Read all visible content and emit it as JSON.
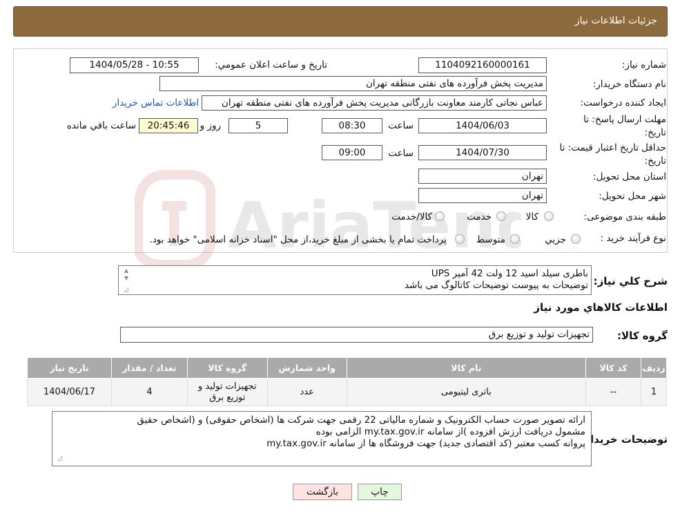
{
  "header": {
    "title": "جزئیات اطلاعات نیاز"
  },
  "form": {
    "need_number_label": "شماره نیاز:",
    "need_number": "1104092160000161",
    "announce_label": "تاریخ و ساعت اعلان عمومي:",
    "announce_value": "1404/05/28 - 10:55",
    "buyer_org_label": "نام دستگاه خریدار:",
    "buyer_org": "مدیریت پخش فرآورده های نفتی منطقه تهران",
    "creator_label": "ایجاد کننده درخواست:",
    "creator": "عباس نجاتی کارمند معاونت بازرگانی مدیریت پخش فرآورده های نفتی منطقه تهران",
    "contact_link": "اطلاعات تماس خریدار",
    "deadline_label": "مهلت ارسال پاسخ: تا تاریخ:",
    "deadline_date": "1404/06/03",
    "time_label": "ساعت",
    "deadline_time": "08:30",
    "days_value": "5",
    "days_label": "روز و",
    "remaining_time": "20:45:46",
    "remaining_label": "ساعت باقي مانده",
    "validity_label": "حداقل تاریخ اعتبار قیمت: تا تاریخ:",
    "validity_date": "1404/07/30",
    "validity_time": "09:00",
    "province_label": "استان محل تحویل:",
    "province": "تهران",
    "city_label": "شهر محل تحویل:",
    "city": "تهران",
    "category_label": "طبقه بندی موضوعی:",
    "category_options": [
      "کالا",
      "خدمت",
      "کالا/خدمت"
    ],
    "process_label": "نوع فرآیند خرید :",
    "process_options": [
      "جزیي",
      "متوسط"
    ],
    "process_note": "پرداخت تمام یا بخشی از مبلغ خرید،از محل \"اسناد خزانه اسلامی\" خواهد بود."
  },
  "description": {
    "label": "شرح کلي نیاز:",
    "lines": [
      "باطری سیلد اسید 12 ولت 42 آمپر UPS",
      "توضیحات به پیوست توضیحات کاتالوگ می باشد"
    ]
  },
  "goods": {
    "section_title": "اطلاعات کالاهاي مورد نیاز",
    "group_label": "گروه کالا:",
    "group_value": "تجهیزات تولید و توزیع برق",
    "columns": [
      "ردیف",
      "کد کالا",
      "نام کالا",
      "واحد شمارش",
      "گروه کالا",
      "تعداد / مقدار",
      "تاریخ نیاز"
    ],
    "rows": [
      [
        "1",
        "--",
        "باتری لیتیومی",
        "عدد",
        "تجهیزات تولید و توزیع برق",
        "4",
        "1404/06/17"
      ]
    ]
  },
  "buyer_notes": {
    "label": "توضیحات خریدار:",
    "lines": [
      "ارائه  تصویر صورت حساب الکترونیک و شماره مالیاتی 22 رقمی  جهت شرکت ها (اشخاص حقوقی) و (اشخاص حقیق",
      "مشمول دریافت ارزش افزوده )از سامانه my.tax.gov.ir  الزامی بوده",
      "پروانه کسب معتبر (کد اقتصادی جدید) جهت فروشگاه ها از سامانه my.tax.gov.ir"
    ]
  },
  "actions": {
    "back": "بازگشت",
    "print": "چاپ"
  },
  "watermark": {
    "text": "AriaTender.neT"
  },
  "colors": {
    "header_bg": "#8c6a3e",
    "table_header": "#aaaaaa",
    "back_btn": "#ffe2e2",
    "print_btn": "#e3f7dc",
    "remaining_bg": "#ffffd2"
  }
}
